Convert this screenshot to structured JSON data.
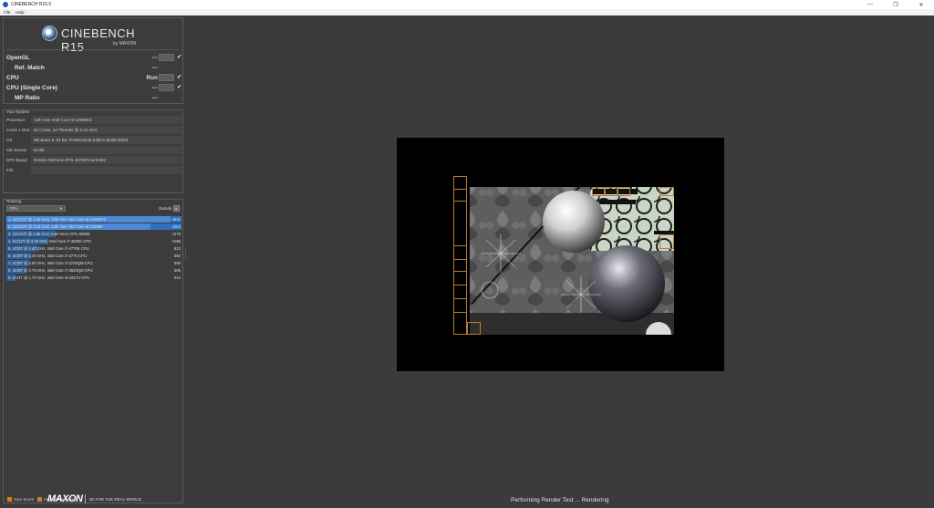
{
  "window": {
    "title": "CINEBENCH R15.0",
    "controls": [
      "minimize",
      "maximize",
      "close"
    ],
    "minimize_glyph": "—",
    "maximize_glyph": "❐",
    "close_glyph": "✕"
  },
  "menu": {
    "items": [
      "File",
      "Help"
    ]
  },
  "logo": {
    "name": "CINEBENCH R15",
    "by": "by MAXON"
  },
  "tests": [
    {
      "label": "OpenGL",
      "value": "---",
      "button": "Run",
      "indented": false
    },
    {
      "label": "Ref. Match",
      "value": "---",
      "indented": true
    },
    {
      "label": "CPU",
      "value": "Run",
      "button": "Run",
      "indented": false
    },
    {
      "label": "CPU (Single Core)",
      "value": "---",
      "button": "Run",
      "indented": false
    },
    {
      "label": "MP Ratio",
      "value": "---",
      "indented": true
    }
  ],
  "check_glyph": "✔",
  "system": {
    "title": "Your System",
    "rows": [
      {
        "key": "Processor",
        "value": "12th Gen Intel Core i9-12900KS"
      },
      {
        "key": "Cores x GHz",
        "value": "24 Cores, 24 Threads @ 3.42 GHz"
      },
      {
        "key": "OS",
        "value": "Windows 8, 64 Bit, Professional Edition (build 9200)"
      },
      {
        "key": "CB Version",
        "value": "64 Bit"
      },
      {
        "key": "GFX Board",
        "value": "NVIDIA GeForce RTX 3070/PCIe/SSE2"
      },
      {
        "key": "Info",
        "value": ""
      }
    ]
  },
  "ranking": {
    "title": "Ranking",
    "dropdown": "CPU",
    "details_label": "Details",
    "rows": [
      {
        "text": "1. 24C/24T @ 3.42 GHz, 12th Gen Intel Core i9-12900KS",
        "score": "4622",
        "fraction": 1.0,
        "highlight": true
      },
      {
        "text": "2. 24C/24T @ 3.19 GHz, 12th Gen Intel Core i9-12900K",
        "score": "4053",
        "fraction": 0.88,
        "highlight": true
      },
      {
        "text": "3. 12C/24T @ 2.66 GHz, Intel Xeon CPU X5650",
        "score": "1279",
        "fraction": 0.28,
        "highlight": false
      },
      {
        "text": "4. 6C/12T @ 3.30 GHz, Intel Core i7-3930K CPU",
        "score": "1096",
        "fraction": 0.24,
        "highlight": false
      },
      {
        "text": "5. 4C/8T @ 4.40 GHz, Intel Core i7-4770K CPU",
        "score": "822",
        "fraction": 0.18,
        "highlight": false
      },
      {
        "text": "6. 4C/8T @ 3.40 GHz, Intel Core i7-3770 CPU",
        "score": "662",
        "fraction": 0.14,
        "highlight": false
      },
      {
        "text": "7. 4C/8T @ 2.60 GHz, Intel Core i7-3720QM CPU",
        "score": "590",
        "fraction": 0.13,
        "highlight": false
      },
      {
        "text": "8. 4C/8T @ 2.79 GHz, Intel Core i7-3840QM CPU",
        "score": "505",
        "fraction": 0.11,
        "highlight": false
      },
      {
        "text": "9. 2C/4T @ 1.70 GHz, Intel Core i5-3317U CPU",
        "score": "214",
        "fraction": 0.05,
        "highlight": false
      }
    ]
  },
  "legend": [
    {
      "label": "Your Score",
      "color": "#e07b1a"
    },
    {
      "label": "Identical System",
      "color": "#b8862e"
    }
  ],
  "footer": {
    "brand": "MAXON",
    "tagline": "3D FOR THE REAL WORLD"
  },
  "status": "Performing Render Test ... Rendering",
  "colors": {
    "accent": "#2f6fbf",
    "bucket": "#c07a30",
    "background": "#3b3b3b"
  }
}
